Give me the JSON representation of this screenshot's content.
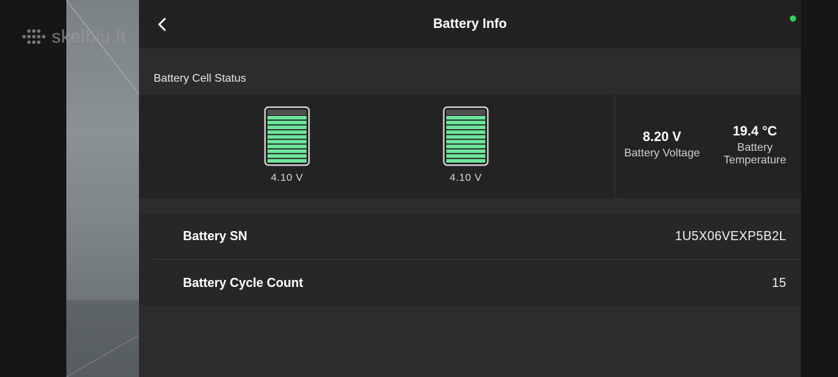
{
  "watermark": {
    "text": "skelbiu.lt"
  },
  "header": {
    "title": "Battery Info",
    "back_icon": "chevron-left-icon"
  },
  "status": {
    "dot_color": "#2ed158"
  },
  "cell_status": {
    "label": "Battery Cell Status",
    "cells": [
      {
        "voltage": "4.10 V",
        "charge_fraction": 1.0
      },
      {
        "voltage": "4.10 V",
        "charge_fraction": 1.0
      }
    ],
    "cell_fill_color": "#6ee49a"
  },
  "stats": {
    "voltage": {
      "value": "8.20 V",
      "label": "Battery Voltage"
    },
    "temperature": {
      "value": "19.4 °C",
      "label_line1": "Battery",
      "label_line2": "Temperature"
    }
  },
  "info_rows": [
    {
      "label": "Battery SN",
      "value": "1U5X06VEXP5B2L"
    },
    {
      "label": "Battery Cycle Count",
      "value": "15"
    }
  ]
}
